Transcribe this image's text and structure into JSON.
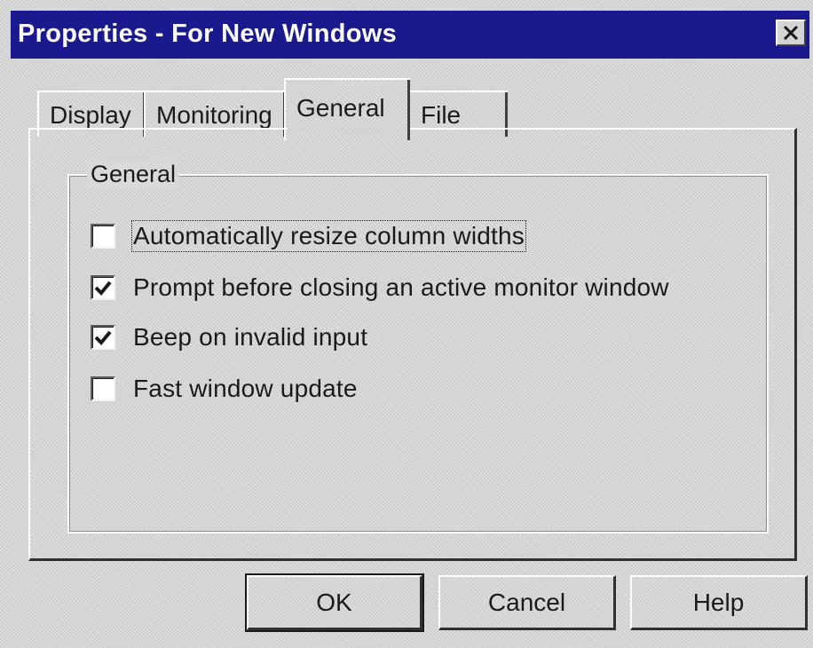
{
  "window": {
    "title": "Properties - For New Windows",
    "close_icon": "close-icon"
  },
  "tabs": [
    {
      "label": "Display",
      "selected": false
    },
    {
      "label": "Monitoring",
      "selected": false
    },
    {
      "label": "General",
      "selected": true
    },
    {
      "label": "File",
      "selected": false
    }
  ],
  "group": {
    "label": "General",
    "options": [
      {
        "label": "Automatically resize column widths",
        "checked": false
      },
      {
        "label": "Prompt before closing an active monitor window",
        "checked": true
      },
      {
        "label": "Beep on invalid input",
        "checked": true
      },
      {
        "label": "Fast window update",
        "checked": false
      }
    ]
  },
  "buttons": {
    "ok": "OK",
    "cancel": "Cancel",
    "help": "Help"
  },
  "colors": {
    "titlebar": "#1a1a8e",
    "face": "#d4d4d4"
  }
}
